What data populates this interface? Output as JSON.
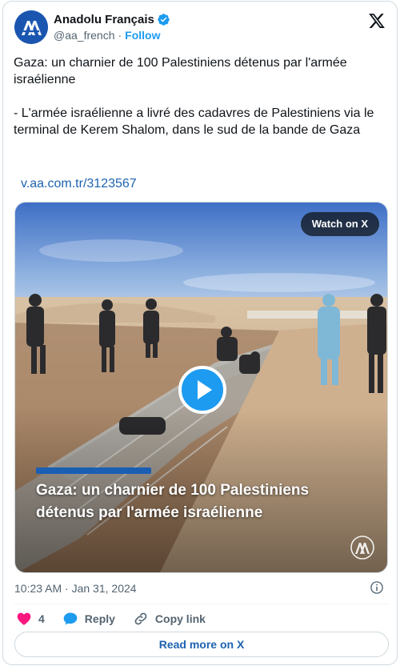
{
  "author": {
    "name": "Anadolu Français",
    "handle": "@aa_french",
    "separator": "·",
    "follow_label": "Follow",
    "avatar_text": "AA"
  },
  "tweet": {
    "paragraph_1": "Gaza: un charnier de 100 Palestiniens détenus par l'armée israélienne",
    "paragraph_2": " - L'armée israélienne a livré des cadavres de Palestiniens via le terminal de Kerem Shalom, dans le sud de la bande de Gaza",
    "link": "v.aa.com.tr/3123567"
  },
  "media": {
    "watch_label": "Watch on X",
    "caption_line_1": "Gaza: un charnier de 100 Palestiniens",
    "caption_line_2": "détenus par l'armée israélienne",
    "watermark_text": "AA"
  },
  "meta": {
    "timestamp": "10:23 AM · Jan 31, 2024"
  },
  "actions": {
    "like_count": "4",
    "reply_label": "Reply",
    "copy_label": "Copy link"
  },
  "footer": {
    "read_more_label": "Read more on X"
  },
  "colors": {
    "brand_blue": "#1d9bf0",
    "link_blue": "#1d63b0",
    "like_red": "#f91880",
    "aa_blue": "#1a56b0"
  },
  "icons": [
    "aa-logo-icon",
    "verified-badge-icon",
    "x-logo-icon",
    "play-icon",
    "info-icon",
    "heart-icon",
    "reply-bubble-icon",
    "link-icon"
  ]
}
